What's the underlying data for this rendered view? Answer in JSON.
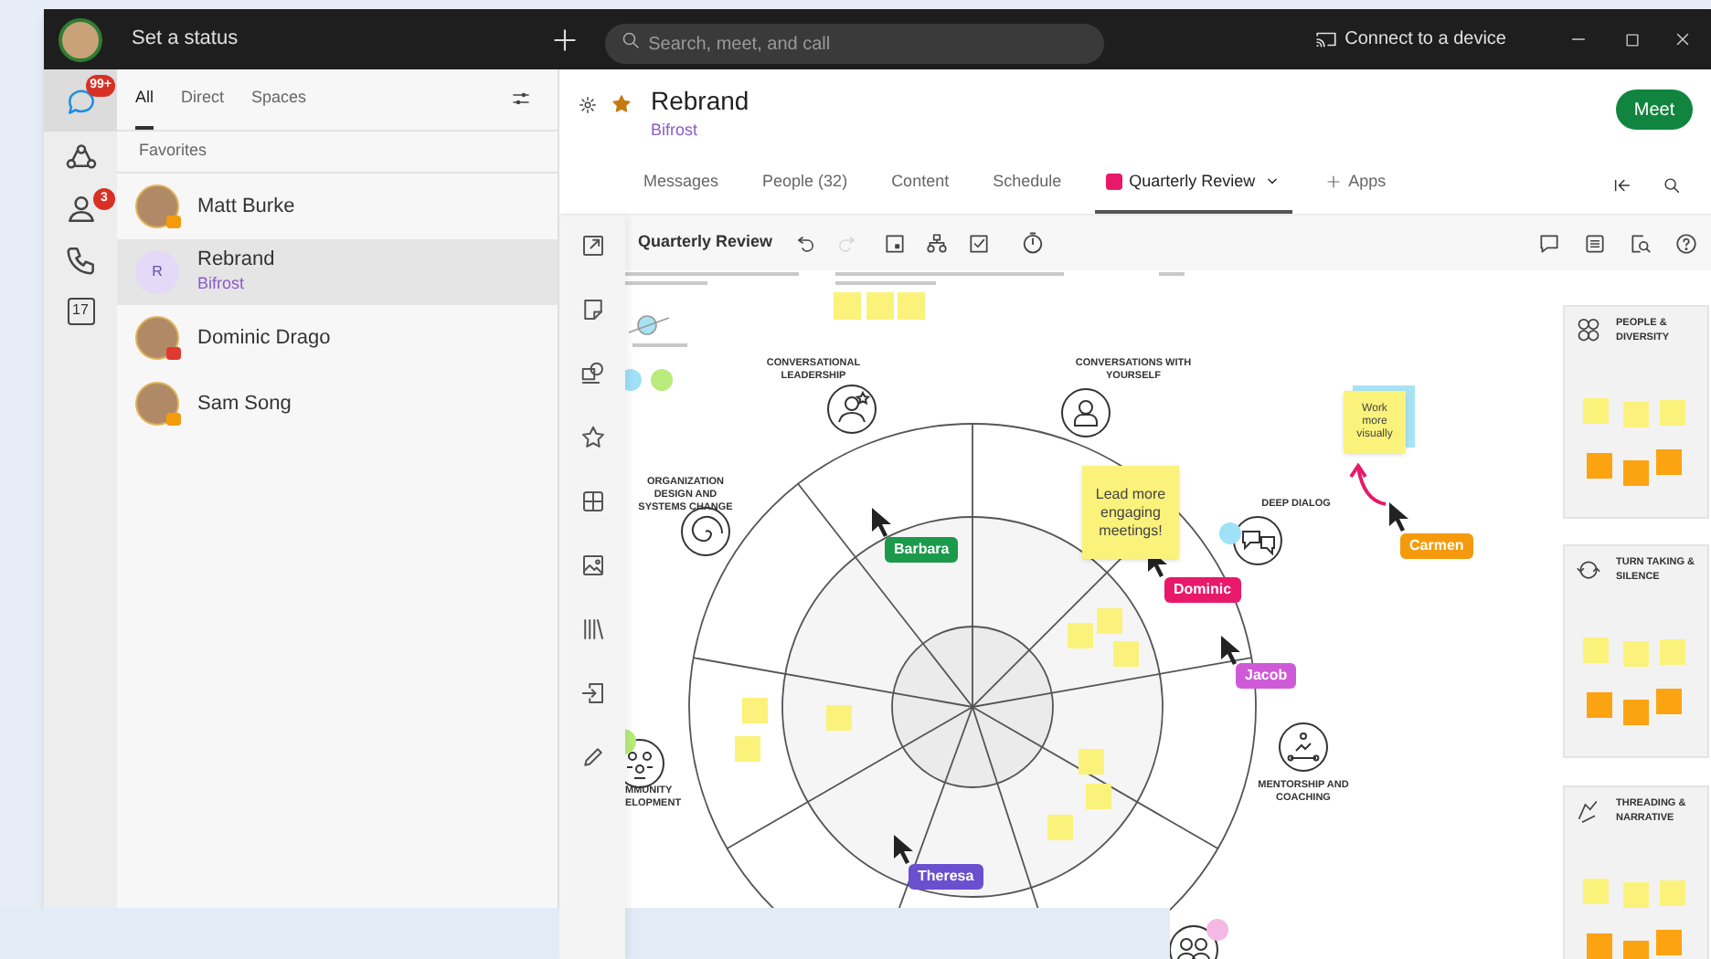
{
  "top_bar": {
    "status": "Set a status",
    "search": {
      "placeholder": "Search, meet, and call"
    },
    "connect": "Connect to a device"
  },
  "rail": [
    {
      "kind": "chat",
      "badge": "99+",
      "selected": true
    },
    {
      "kind": "teams",
      "selected": false
    },
    {
      "kind": "contacts",
      "badge": "3",
      "selected": false
    },
    {
      "kind": "calls",
      "selected": false
    },
    {
      "kind": "calendar",
      "day": "17",
      "selected": false
    }
  ],
  "list": {
    "tabs": [
      {
        "label": "All",
        "selected": true
      },
      {
        "label": "Direct",
        "selected": false
      },
      {
        "label": "Spaces",
        "selected": false
      }
    ],
    "section": "Favorites",
    "items": [
      {
        "kind": "person",
        "name": "Matt Burke",
        "color": "#f59a0c",
        "selected": false
      },
      {
        "kind": "space",
        "name": "Rebrand",
        "subtitle": "Bifrost",
        "initial": "R",
        "selected": true
      },
      {
        "kind": "person",
        "name": "Dominic Drago",
        "color": "#e03a2f",
        "selected": false
      },
      {
        "kind": "person",
        "name": "Sam Song",
        "color": "#f59a0c",
        "selected": false
      }
    ]
  },
  "space": {
    "title": "Rebrand",
    "subtitle": "Bifrost",
    "favorite": true,
    "meet": "Meet",
    "tabs": [
      {
        "kind": "tab",
        "label": "Messages",
        "selected": false
      },
      {
        "kind": "tab",
        "label": "People (32)",
        "selected": false
      },
      {
        "kind": "tab",
        "label": "Content",
        "selected": false
      },
      {
        "kind": "tab",
        "label": "Schedule",
        "selected": false
      },
      {
        "kind": "app",
        "label": "Quarterly Review",
        "selected": true
      },
      {
        "kind": "add",
        "label": "Apps",
        "selected": false
      }
    ]
  },
  "board": {
    "title": "Quarterly Review",
    "redo_disabled": true,
    "topics": [
      {
        "label": "CONVERSATIONAL LEADERSHIP"
      },
      {
        "label": "CONVERSATIONS WITH YOURSELF"
      },
      {
        "label": "ORGANIZATION DESIGN AND SYSTEMS CHANGE"
      },
      {
        "label": "DEEP DIALOG"
      },
      {
        "label": "MENTORSHIP AND COACHING"
      },
      {
        "label": "MMUNITY ELOPMENT"
      }
    ],
    "notes": [
      {
        "text": "Lead more engaging meetings!"
      },
      {
        "text": "Work more visually"
      }
    ],
    "collaborators": [
      {
        "name": "Barbara",
        "color": "#1a9a4a"
      },
      {
        "name": "Dominic",
        "color": "#e8196a"
      },
      {
        "name": "Jacob",
        "color": "#cf5ad8"
      },
      {
        "name": "Carmen",
        "color": "#f59a0c"
      },
      {
        "name": "Theresa",
        "color": "#6a4fcf"
      }
    ],
    "categories": [
      {
        "title": "PEOPLE & DIVERSITY"
      },
      {
        "title": "TURN TAKING & SILENCE"
      },
      {
        "title": "THREADING & NARRATIVE"
      }
    ]
  }
}
